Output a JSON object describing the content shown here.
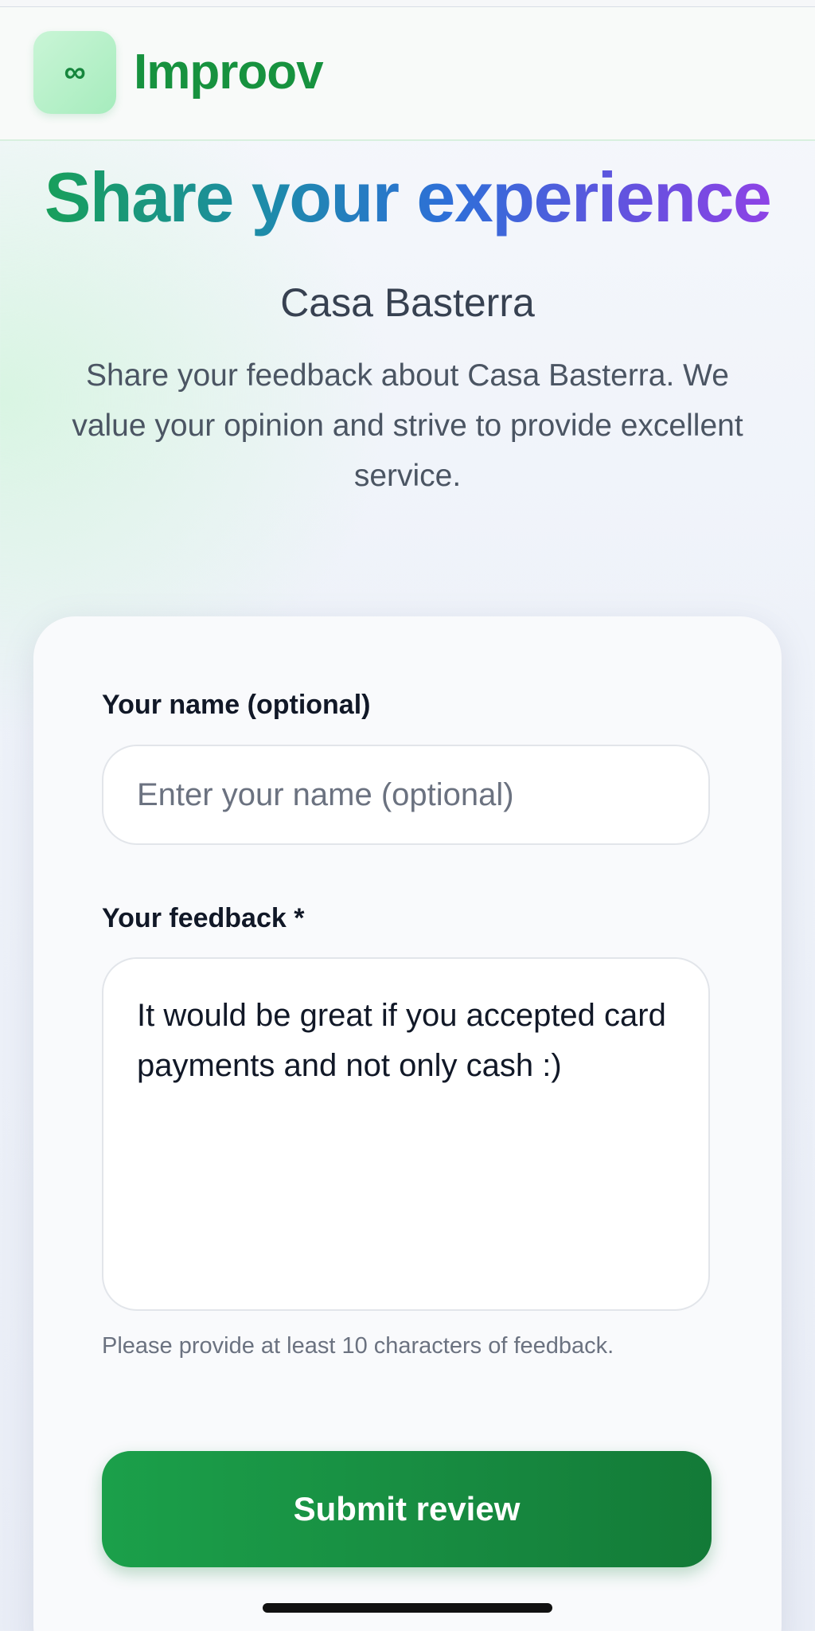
{
  "header": {
    "logo_icon": "infinity-icon",
    "logo_glyph": "∞",
    "brand_name": "Improov",
    "brand_color": "#17923f"
  },
  "hero": {
    "title": "Share your experience",
    "venue_name": "Casa Basterra",
    "subtitle": "Share your feedback about Casa Basterra. We value your opinion and strive to provide excellent service."
  },
  "form": {
    "name_label": "Your name (optional)",
    "name_placeholder": "Enter your name (optional)",
    "name_value": "",
    "feedback_label": "Your feedback *",
    "feedback_value": "It would be great if you accepted card payments and not only cash :)",
    "hint": "Please provide at least 10 characters of feedback.",
    "submit_label": "Submit review",
    "accent_color": "#1ba04a"
  }
}
